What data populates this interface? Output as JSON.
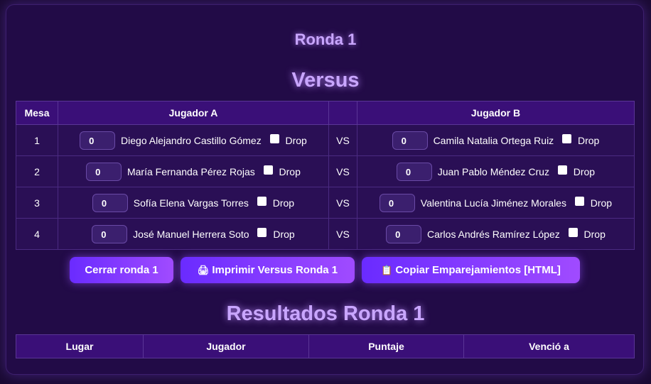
{
  "ronda_title": "Ronda 1",
  "versus_title": "Versus",
  "versus_table": {
    "headers": {
      "mesa": "Mesa",
      "jugador_a": "Jugador A",
      "vs": "",
      "jugador_b": "Jugador B"
    },
    "rows": [
      {
        "mesa": "1",
        "a_score": "0",
        "a_name": "Diego Alejandro Castillo Gómez",
        "vs": "VS",
        "b_score": "0",
        "b_name": "Camila Natalia Ortega Ruiz",
        "drop": "Drop"
      },
      {
        "mesa": "2",
        "a_score": "0",
        "a_name": "María Fernanda Pérez Rojas",
        "vs": "VS",
        "b_score": "0",
        "b_name": "Juan Pablo Méndez Cruz",
        "drop": "Drop"
      },
      {
        "mesa": "3",
        "a_score": "0",
        "a_name": "Sofía Elena Vargas Torres",
        "vs": "VS",
        "b_score": "0",
        "b_name": "Valentina Lucía Jiménez Morales",
        "drop": "Drop"
      },
      {
        "mesa": "4",
        "a_score": "0",
        "a_name": "José Manuel Herrera Soto",
        "vs": "VS",
        "b_score": "0",
        "b_name": "Carlos Andrés Ramírez López",
        "drop": "Drop"
      }
    ]
  },
  "buttons": {
    "cerrar": "Cerrar ronda 1",
    "imprimir": "Imprimir Versus Ronda 1",
    "copiar": "Copiar Emparejamientos [HTML]"
  },
  "icons": {
    "imprimir": "printer-icon",
    "copiar": "clipboard-icon"
  },
  "resultados_title": "Resultados Ronda 1",
  "results_table": {
    "headers": {
      "lugar": "Lugar",
      "jugador": "Jugador",
      "puntaje": "Puntaje",
      "vencio": "Venció a"
    }
  },
  "colors": {
    "accent": "#a04bff",
    "background": "#1a0a33",
    "title": "#c9a6ff"
  }
}
